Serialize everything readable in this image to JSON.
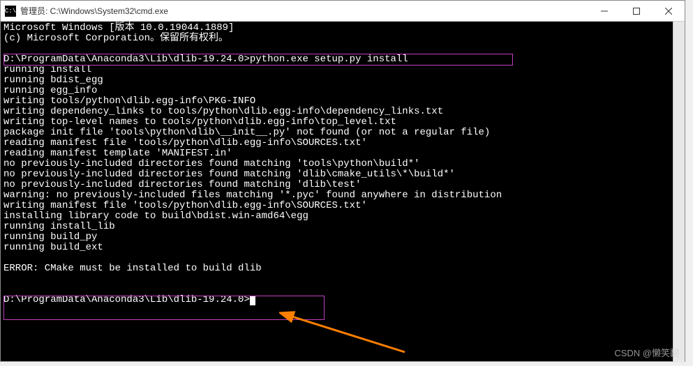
{
  "window": {
    "title": "管理员: C:\\Windows\\System32\\cmd.exe",
    "icon_text": "C:\\"
  },
  "terminal": {
    "line0": "Microsoft Windows [版本 10.0.19044.1889]",
    "line1": "(c) Microsoft Corporation。保留所有权利。",
    "line2": "",
    "prompt1": "D:\\ProgramData\\Anaconda3\\Lib\\dlib-19.24.0>",
    "cmd1": "python.exe setup.py install",
    "lines_output": [
      "running install",
      "running bdist_egg",
      "running egg_info",
      "writing tools/python\\dlib.egg-info\\PKG-INFO",
      "writing dependency_links to tools/python\\dlib.egg-info\\dependency_links.txt",
      "writing top-level names to tools/python\\dlib.egg-info\\top_level.txt",
      "package init file 'tools\\python\\dlib\\__init__.py' not found (or not a regular file)",
      "reading manifest file 'tools/python\\dlib.egg-info\\SOURCES.txt'",
      "reading manifest template 'MANIFEST.in'",
      "no previously-included directories found matching 'tools\\python\\build*'",
      "no previously-included directories found matching 'dlib\\cmake_utils\\*\\build*'",
      "no previously-included directories found matching 'dlib\\test'",
      "warning: no previously-included files matching '*.pyc' found anywhere in distribution",
      "writing manifest file 'tools/python\\dlib.egg-info\\SOURCES.txt'",
      "installing library code to build\\bdist.win-amd64\\egg",
      "running install_lib",
      "running build_py",
      "running build_ext"
    ],
    "blank1": "",
    "error_line": "ERROR: CMake must be installed to build dlib",
    "blank2": "",
    "blank3": "",
    "prompt2": "D:\\ProgramData\\Anaconda3\\Lib\\dlib-19.24.0>"
  },
  "watermark": "CSDN @懒笑翻"
}
